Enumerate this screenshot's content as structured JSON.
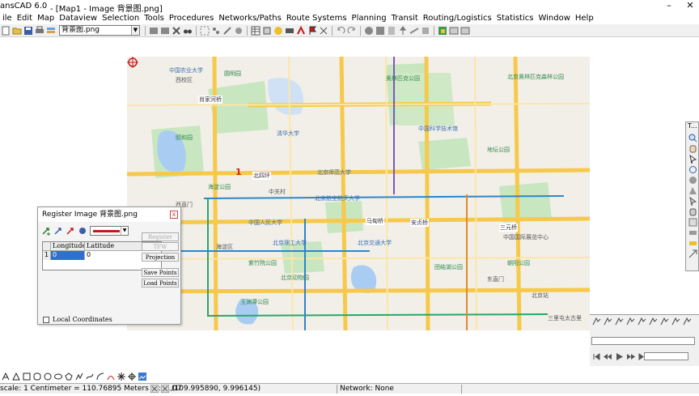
{
  "window": {
    "app_title": "ansCAD 6.0",
    "doc_title": "- [Map1 - Image 背景图.png]",
    "minimize": "–",
    "close": "✕"
  },
  "menu": [
    "ile",
    "Edit",
    "Map",
    "Dataview",
    "Selection",
    "Tools",
    "Procedures",
    "Networks/Paths",
    "Route Systems",
    "Planning",
    "Transit",
    "Routing/Logistics",
    "Statistics",
    "Window",
    "Help"
  ],
  "toolbar": {
    "layer_value": "背景图.png"
  },
  "map": {
    "registration_point_label": "1",
    "places": [
      {
        "text": "中国农业大学",
        "cls": "blue"
      },
      {
        "text": "西校区",
        "cls": ""
      },
      {
        "text": "肖家河桥",
        "cls": "road"
      },
      {
        "text": "圆明园",
        "cls": "green"
      },
      {
        "text": "清华大学",
        "cls": "blue"
      },
      {
        "text": "颐和园",
        "cls": "green"
      },
      {
        "text": "北四环",
        "cls": "road"
      },
      {
        "text": "海淀公园",
        "cls": "green"
      },
      {
        "text": "中关村",
        "cls": ""
      },
      {
        "text": "北京师范大学",
        "cls": "blue"
      },
      {
        "text": "北京航空航天大学",
        "cls": "blue"
      },
      {
        "text": "中国人民大学",
        "cls": "blue"
      },
      {
        "text": "北京理工大学",
        "cls": "blue"
      },
      {
        "text": "北京交通大学",
        "cls": "blue"
      },
      {
        "text": "紫竹院公园",
        "cls": "green"
      },
      {
        "text": "北京动物园",
        "cls": "green"
      },
      {
        "text": "海淀区",
        "cls": ""
      },
      {
        "text": "奥林匹克公园",
        "cls": "green"
      },
      {
        "text": "北京奥林匹克森林公园",
        "cls": "green"
      },
      {
        "text": "中国科学技术馆",
        "cls": "blue"
      },
      {
        "text": "地坛公园",
        "cls": "green"
      },
      {
        "text": "西直门",
        "cls": ""
      },
      {
        "text": "马甸桥",
        "cls": "road"
      },
      {
        "text": "安贞桥",
        "cls": "road"
      },
      {
        "text": "三元桥",
        "cls": "road"
      },
      {
        "text": "朝阳公园",
        "cls": "green"
      },
      {
        "text": "中国国际展览中心",
        "cls": ""
      },
      {
        "text": "东直门",
        "cls": ""
      },
      {
        "text": "北京站",
        "cls": ""
      },
      {
        "text": "三里屯太古里",
        "cls": ""
      },
      {
        "text": "玉渊潭公园",
        "cls": "green"
      },
      {
        "text": "团结湖公园",
        "cls": "green"
      }
    ]
  },
  "dialog": {
    "title": "Register Image 背景图.png",
    "close": "x",
    "columns": [
      "",
      "Longitude",
      "Latitude"
    ],
    "rows": [
      {
        "n": "1",
        "lon": "0",
        "lat": "0"
      }
    ],
    "buttons": {
      "register": "Register",
      "tfw": "TFW",
      "projection": "Projection",
      "save_points": "Save Points",
      "load_points": "Load Points"
    },
    "local_coordinates": "Local Coordinates",
    "accent": "#c41a1a"
  },
  "right_panel": {
    "title": "T..."
  },
  "status": {
    "scale": "scale: 1 Centimeter = 110.76895 Meters (1:11,07",
    "coords": "(109.995890, 9.996145)",
    "network": "Network: None"
  },
  "colors": {
    "map_bg": "#f2efe9",
    "major_road": "#f6c94a",
    "water": "#a9cdf2",
    "park": "#c8e6c0",
    "metro_blue": "#2e86c8",
    "metro_green": "#2aa56b"
  }
}
